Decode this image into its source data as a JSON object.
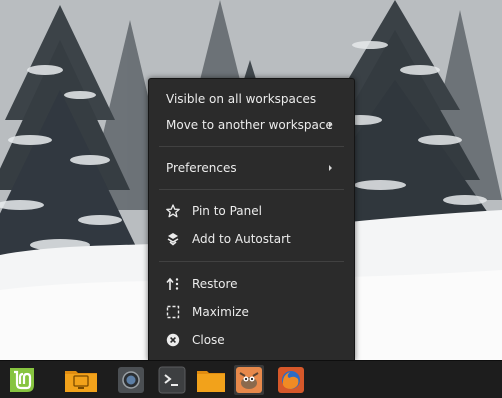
{
  "context_menu": {
    "items": [
      {
        "label": "Visible on all workspaces"
      },
      {
        "label": "Move to another workspace",
        "submenu": true
      },
      {
        "label": "Preferences",
        "submenu": true
      },
      {
        "label": "Pin to Panel",
        "icon": "star-icon"
      },
      {
        "label": "Add to Autostart",
        "icon": "autostart-icon"
      },
      {
        "label": "Restore",
        "icon": "restore-icon"
      },
      {
        "label": "Maximize",
        "icon": "maximize-icon"
      },
      {
        "label": "Close",
        "icon": "close-icon"
      }
    ]
  },
  "taskbar": {
    "items": [
      {
        "icon": "linux-mint-menu-icon"
      },
      {
        "icon": "display-settings-folder-icon"
      },
      {
        "icon": "screen-recorder-icon"
      },
      {
        "icon": "terminal-icon"
      },
      {
        "icon": "files-folder-icon"
      },
      {
        "icon": "gimp-icon",
        "active": true
      },
      {
        "icon": "firefox-icon"
      }
    ]
  },
  "colors": {
    "menu_bg": "#2b2b2b",
    "menu_text": "#ececec",
    "taskbar_bg": "#1d1d1d",
    "mint_green": "#87c440",
    "folder_orange": "#f2a21b"
  }
}
